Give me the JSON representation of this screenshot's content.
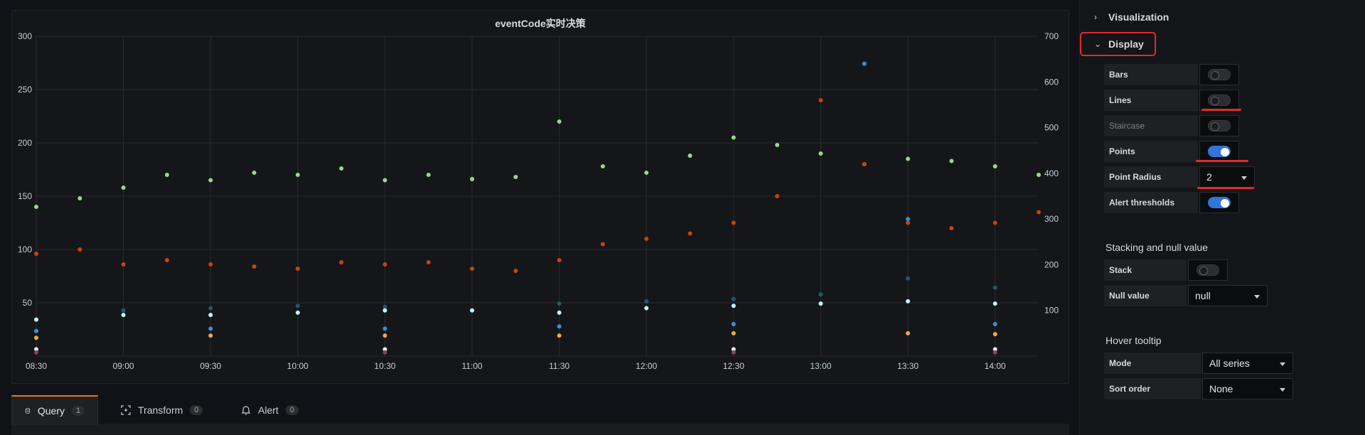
{
  "panel": {
    "title": "eventCode实时决策"
  },
  "chart_data": {
    "type": "scatter",
    "title": "eventCode实时决策",
    "x_ticks": [
      "08:30",
      "09:00",
      "09:30",
      "10:00",
      "10:30",
      "11:00",
      "11:30",
      "12:00",
      "12:30",
      "13:00",
      "13:30",
      "14:00"
    ],
    "x_range": [
      "08:30",
      "14:15"
    ],
    "y_left": {
      "ticks": [
        50,
        100,
        150,
        200,
        250,
        300
      ],
      "range": [
        0,
        300
      ]
    },
    "y_right": {
      "ticks": [
        100,
        200,
        300,
        400,
        500,
        600,
        700
      ],
      "range": [
        0,
        700
      ]
    },
    "grid": true,
    "legend": "none",
    "point_radius": 2,
    "series": [
      {
        "color": "#96d98d",
        "axis": "left",
        "points": [
          [
            "08:30",
            140
          ],
          [
            "08:45",
            148
          ],
          [
            "09:00",
            158
          ],
          [
            "09:15",
            170
          ],
          [
            "09:30",
            165
          ],
          [
            "09:45",
            172
          ],
          [
            "10:00",
            170
          ],
          [
            "10:15",
            176
          ],
          [
            "10:30",
            165
          ],
          [
            "10:45",
            170
          ],
          [
            "11:00",
            166
          ],
          [
            "11:15",
            168
          ],
          [
            "11:30",
            220
          ],
          [
            "11:45",
            178
          ],
          [
            "12:00",
            172
          ],
          [
            "12:15",
            188
          ],
          [
            "12:30",
            205
          ],
          [
            "12:45",
            198
          ],
          [
            "13:00",
            190
          ],
          [
            "13:15",
            180
          ],
          [
            "13:30",
            185
          ],
          [
            "13:45",
            183
          ],
          [
            "14:00",
            178
          ],
          [
            "14:15",
            170
          ]
        ]
      },
      {
        "color": "#c4450f",
        "axis": "left",
        "points": [
          [
            "08:30",
            96
          ],
          [
            "08:45",
            100
          ],
          [
            "09:00",
            86
          ],
          [
            "09:15",
            90
          ],
          [
            "09:30",
            86
          ],
          [
            "09:45",
            84
          ],
          [
            "10:00",
            82
          ],
          [
            "10:15",
            88
          ],
          [
            "10:30",
            86
          ],
          [
            "10:45",
            88
          ],
          [
            "11:00",
            82
          ],
          [
            "11:15",
            80
          ],
          [
            "11:30",
            90
          ],
          [
            "11:45",
            105
          ],
          [
            "12:00",
            110
          ],
          [
            "12:15",
            115
          ],
          [
            "12:30",
            125
          ],
          [
            "12:45",
            150
          ],
          [
            "13:00",
            240
          ],
          [
            "13:15",
            180
          ],
          [
            "13:30",
            125
          ],
          [
            "13:45",
            120
          ],
          [
            "14:00",
            125
          ],
          [
            "14:15",
            135
          ]
        ]
      },
      {
        "color": "#1f5a6b",
        "axis": "right",
        "points": [
          [
            "08:30",
            80
          ],
          [
            "09:00",
            100
          ],
          [
            "09:30",
            105
          ],
          [
            "10:00",
            110
          ],
          [
            "10:30",
            108
          ],
          [
            "11:00",
            100
          ],
          [
            "11:30",
            115
          ],
          [
            "12:00",
            120
          ],
          [
            "12:30",
            125
          ],
          [
            "13:00",
            135
          ],
          [
            "13:30",
            170
          ],
          [
            "14:00",
            150
          ]
        ]
      },
      {
        "color": "#3a8fd6",
        "axis": "right",
        "points": [
          [
            "08:30",
            55
          ],
          [
            "09:30",
            60
          ],
          [
            "10:30",
            60
          ],
          [
            "11:30",
            65
          ],
          [
            "12:30",
            70
          ],
          [
            "13:15",
            640
          ],
          [
            "13:30",
            300
          ],
          [
            "14:00",
            70
          ]
        ]
      },
      {
        "color": "#c0f4ff",
        "axis": "right",
        "points": [
          [
            "08:30",
            80
          ],
          [
            "09:00",
            90
          ],
          [
            "09:30",
            90
          ],
          [
            "10:00",
            95
          ],
          [
            "10:30",
            100
          ],
          [
            "11:00",
            100
          ],
          [
            "11:30",
            95
          ],
          [
            "12:00",
            105
          ],
          [
            "12:30",
            110
          ],
          [
            "13:00",
            115
          ],
          [
            "13:30",
            120
          ],
          [
            "14:00",
            115
          ]
        ]
      },
      {
        "color": "#f2a740",
        "axis": "right",
        "points": [
          [
            "08:30",
            40
          ],
          [
            "09:30",
            45
          ],
          [
            "10:30",
            45
          ],
          [
            "11:30",
            45
          ],
          [
            "12:30",
            50
          ],
          [
            "13:30",
            50
          ],
          [
            "14:00",
            48
          ]
        ]
      },
      {
        "color": "#e8e8e8",
        "axis": "right",
        "points": [
          [
            "08:30",
            15
          ],
          [
            "10:30",
            15
          ],
          [
            "12:30",
            15
          ],
          [
            "14:00",
            15
          ]
        ]
      },
      {
        "color": "#8e3a6e",
        "axis": "right",
        "points": [
          [
            "08:30",
            8
          ],
          [
            "10:30",
            8
          ],
          [
            "12:30",
            8
          ],
          [
            "14:00",
            8
          ]
        ]
      }
    ]
  },
  "tabs": [
    {
      "label": "Query",
      "count": "1",
      "icon": "database-icon",
      "active": true
    },
    {
      "label": "Transform",
      "count": "0",
      "icon": "transform-icon",
      "active": false
    },
    {
      "label": "Alert",
      "count": "0",
      "icon": "bell-icon",
      "active": false
    }
  ],
  "options": {
    "visualization_label": "Visualization",
    "display_label": "Display",
    "display": {
      "bars": {
        "label": "Bars",
        "on": false
      },
      "lines": {
        "label": "Lines",
        "on": false
      },
      "staircase": {
        "label": "Staircase",
        "on": false
      },
      "points": {
        "label": "Points",
        "on": true
      },
      "point_radius": {
        "label": "Point Radius",
        "value": "2"
      },
      "alert_thresholds": {
        "label": "Alert thresholds",
        "on": true
      }
    },
    "stacking": {
      "title": "Stacking and null value",
      "stack": {
        "label": "Stack",
        "on": false
      },
      "null_value": {
        "label": "Null value",
        "value": "null"
      }
    },
    "hover": {
      "title": "Hover tooltip",
      "mode": {
        "label": "Mode",
        "value": "All series"
      },
      "sort_order": {
        "label": "Sort order",
        "value": "None"
      }
    }
  },
  "colors": {
    "accent": "#3274d9",
    "highlight": "#e02b2b",
    "tab_active": "#eb7b18"
  }
}
